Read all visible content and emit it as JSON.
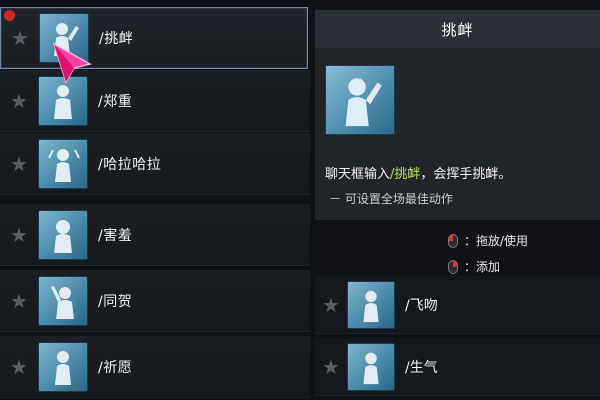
{
  "list": {
    "items": [
      {
        "label": "/挑衅",
        "icon": "taunt-pose-icon",
        "selected": true
      },
      {
        "label": "/郑重",
        "icon": "solemn-pose-icon"
      },
      {
        "label": "/哈拉哈拉",
        "icon": "flutter-pose-icon"
      },
      {
        "label": "/害羞",
        "icon": "shy-pose-icon"
      },
      {
        "label": "/同贺",
        "icon": "congratulate-pose-icon"
      },
      {
        "label": "/祈愿",
        "icon": "pray-pose-icon"
      }
    ]
  },
  "right_list": {
    "items": [
      {
        "label": "/飞吻",
        "icon": "blow-kiss-pose-icon"
      },
      {
        "label": "/生气",
        "icon": "angry-pose-icon"
      }
    ]
  },
  "tooltip": {
    "title": "挑衅",
    "desc_prefix": "聊天框输入",
    "desc_command": "/挑衅",
    "desc_suffix": "，会挥手挑衅。",
    "note": "－ 可设置全场最佳动作"
  },
  "hints": {
    "drag_use": "：拖放/使用",
    "add": "：添加"
  },
  "colors": {
    "accent_green": "#b7e05a",
    "selection_border": "#6a8cab",
    "thumb_blue": "#4a8aa8",
    "red_indicator": "#d4252b"
  }
}
